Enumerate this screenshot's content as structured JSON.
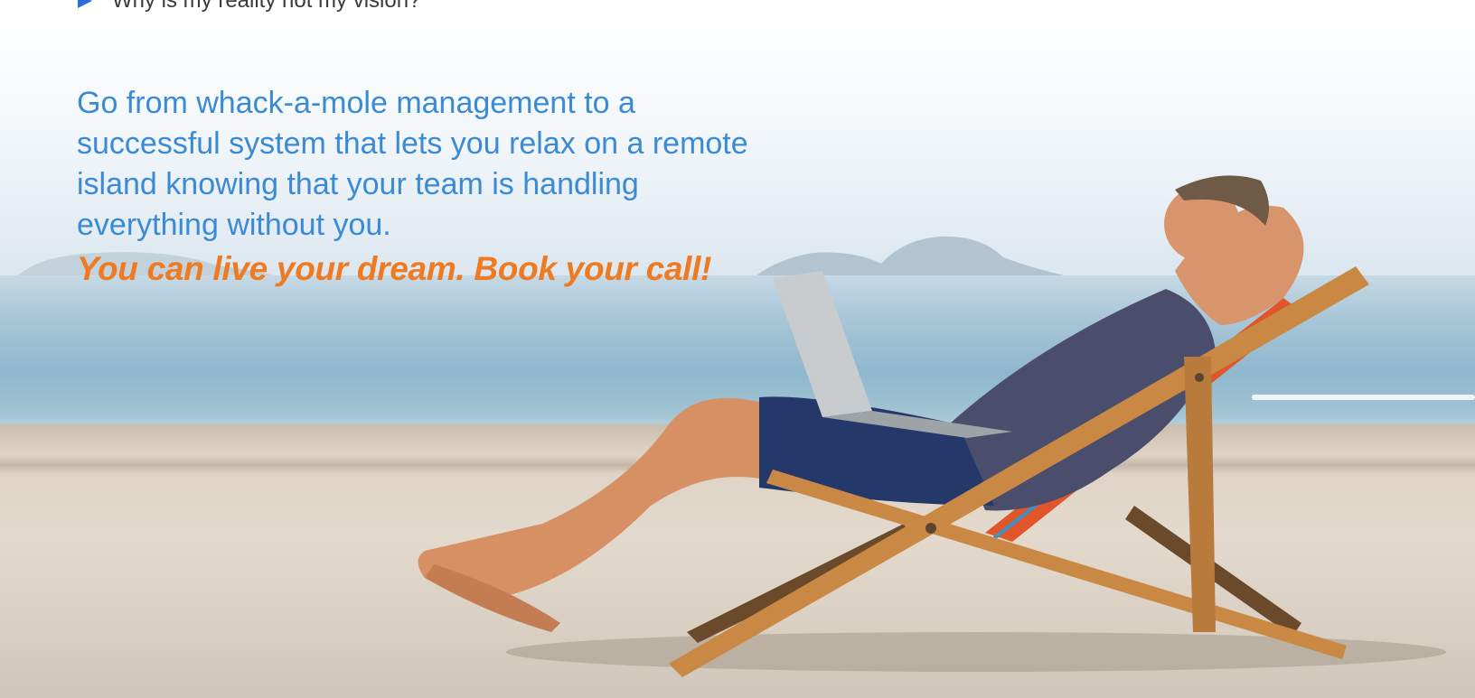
{
  "bullet": {
    "text": "Why is my reality not my vision?",
    "icon": "triangle-right-icon",
    "color": "#2b6fd6"
  },
  "headline": {
    "text": "Go from whack-a-mole management to a successful system that lets you relax on a remote island knowing that your team is handling everything without you.",
    "color": "#3a8ad6"
  },
  "cta": {
    "text": "You can live your dream. Book your call!",
    "color": "#ee7a22"
  }
}
